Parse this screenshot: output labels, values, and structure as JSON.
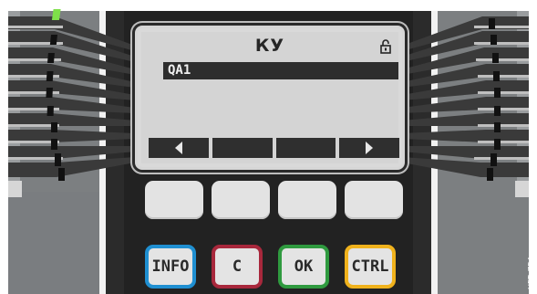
{
  "screen": {
    "title": "КУ",
    "selected_item": "QA1",
    "lock_icon": "lock-icon",
    "softkeys": [
      "arrow-left-icon",
      "",
      "",
      "arrow-right-icon"
    ]
  },
  "keys": {
    "info": "INFO",
    "clear": "C",
    "ok": "OK",
    "ctrl": "CTRL"
  },
  "colors": {
    "led": "#7ee04a",
    "info_border": "#1f8fd1",
    "clear_border": "#a8283c",
    "ok_border": "#2f9a3f",
    "ctrl_border": "#f0b21c",
    "panel": "#222222",
    "side_panel": "#7b7e80"
  },
  "side_label": "HPT_ZB4"
}
